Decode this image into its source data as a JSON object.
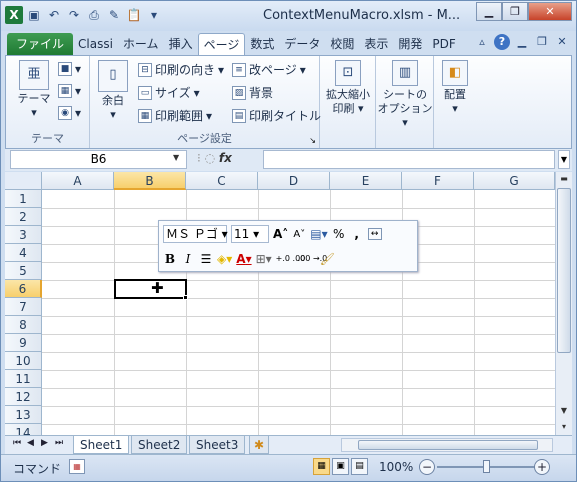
{
  "title": "ContextMenuMacro.xlsm - M...",
  "window_buttons": {
    "minimize": "▁",
    "restore": "❐",
    "close": "✕"
  },
  "qat_icons": [
    "excel-icon",
    "save-icon",
    "undo-icon",
    "redo-icon",
    "print-icon",
    "draw-icon",
    "paste-icon",
    "more-icon"
  ],
  "tabs": [
    "ファイル",
    "Classi",
    "ホーム",
    "挿入",
    "ページ",
    "数式",
    "データ",
    "校閲",
    "表示",
    "開発",
    "PDF"
  ],
  "ribbon": {
    "theme": {
      "button": "テーマ",
      "group": "テーマ"
    },
    "margin": "余白",
    "page_setup": {
      "orientation": "印刷の向き",
      "size": "サイズ",
      "print_area": "印刷範囲",
      "breaks": "改ページ",
      "background": "背景",
      "print_titles": "印刷タイトル",
      "group": "ページ設定"
    },
    "scale": {
      "line1": "拡大縮小",
      "line2": "印刷"
    },
    "sheet_options": {
      "line1": "シートの",
      "line2": "オプション"
    },
    "arrange": "配置"
  },
  "formula_bar": {
    "name_box": "B6",
    "fx": "fx",
    "formula": ""
  },
  "columns": [
    "A",
    "B",
    "C",
    "D",
    "E",
    "F",
    "G"
  ],
  "selected_column": "B",
  "rows": [
    "1",
    "2",
    "3",
    "4",
    "5",
    "6",
    "7",
    "8",
    "9",
    "10",
    "11",
    "12",
    "13",
    "14"
  ],
  "selected_row": "6",
  "mini_toolbar": {
    "font": "ＭＳ Ｐゴ",
    "size": "11",
    "grow": "A",
    "shrink": "A",
    "percent": "%",
    "comma": ",",
    "bold": "B",
    "italic": "I",
    "font_color": "A",
    "dec_increase": "+.0 .00",
    "dec_decrease": ".00 →.0"
  },
  "sheets": [
    "Sheet1",
    "Sheet2",
    "Sheet3"
  ],
  "active_sheet": "Sheet1",
  "status": {
    "mode": "コマンド",
    "zoom": "100%",
    "zoom_out": "−",
    "zoom_in": "+"
  },
  "colors": {
    "file_tab": "#2b8a3e",
    "selection": "#f7cf6c",
    "chrome": "#cfdef0"
  }
}
